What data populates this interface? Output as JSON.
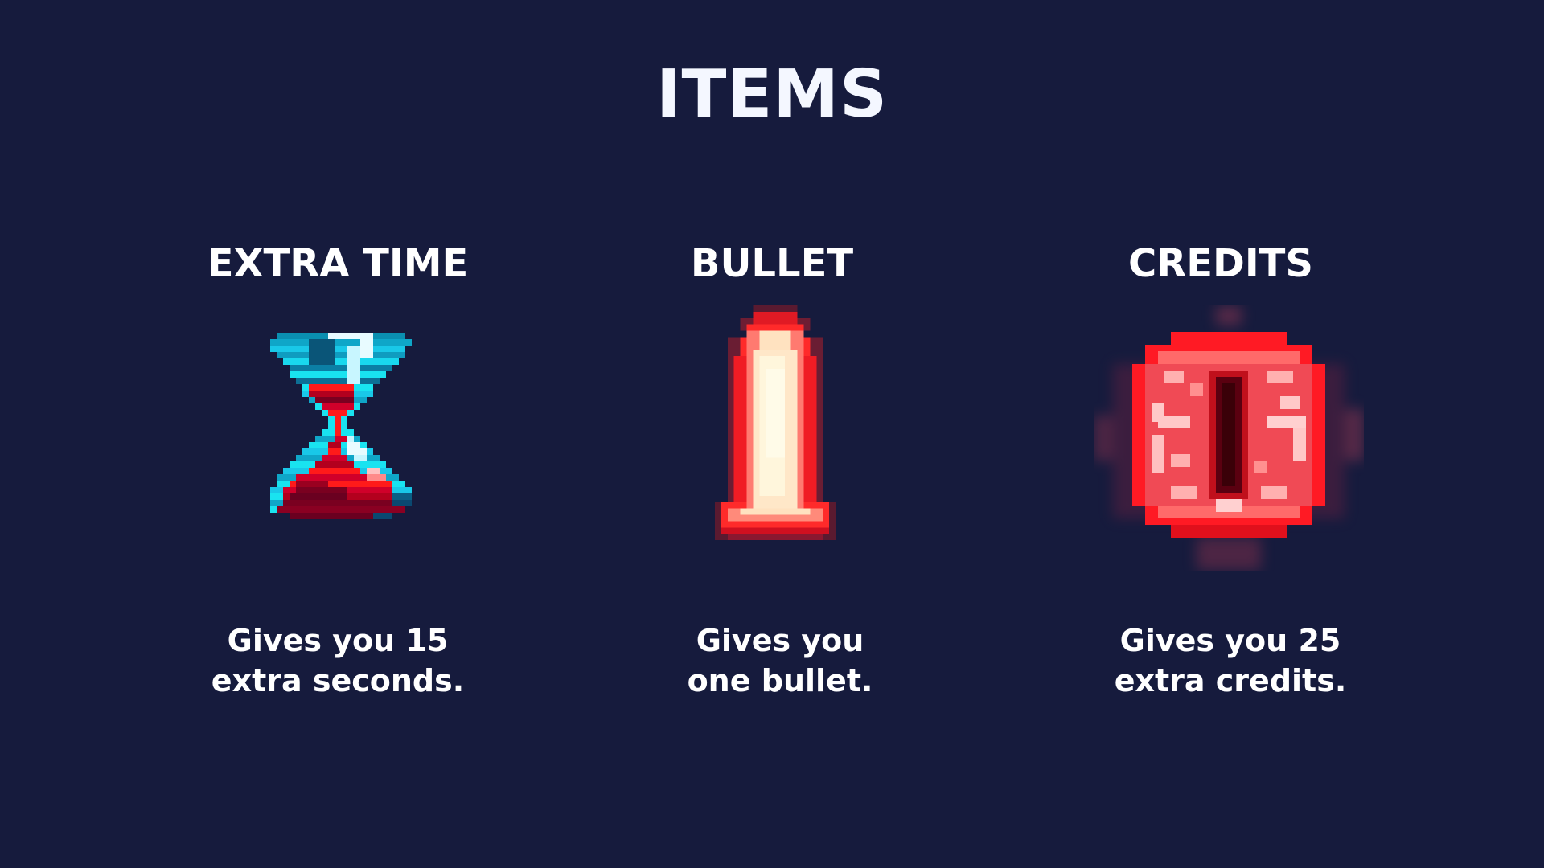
{
  "screen": {
    "title": "ITEMS",
    "background": "#161b3d"
  },
  "items": [
    {
      "name": "EXTRA TIME",
      "icon": "hourglass-icon",
      "desc_line1": "Gives you 15",
      "desc_line2": "extra seconds."
    },
    {
      "name": "BULLET",
      "icon": "bullet-icon",
      "desc_line1": "Gives you",
      "desc_line2": "one bullet."
    },
    {
      "name": "CREDITS",
      "icon": "credit-coin-icon",
      "desc_line1": "Gives you 25",
      "desc_line2": "extra credits."
    }
  ],
  "colors": {
    "cyan": "#19e3f0",
    "red": "#ff1a1a",
    "dark_red": "#7a0020",
    "cream": "#fff4d0"
  }
}
